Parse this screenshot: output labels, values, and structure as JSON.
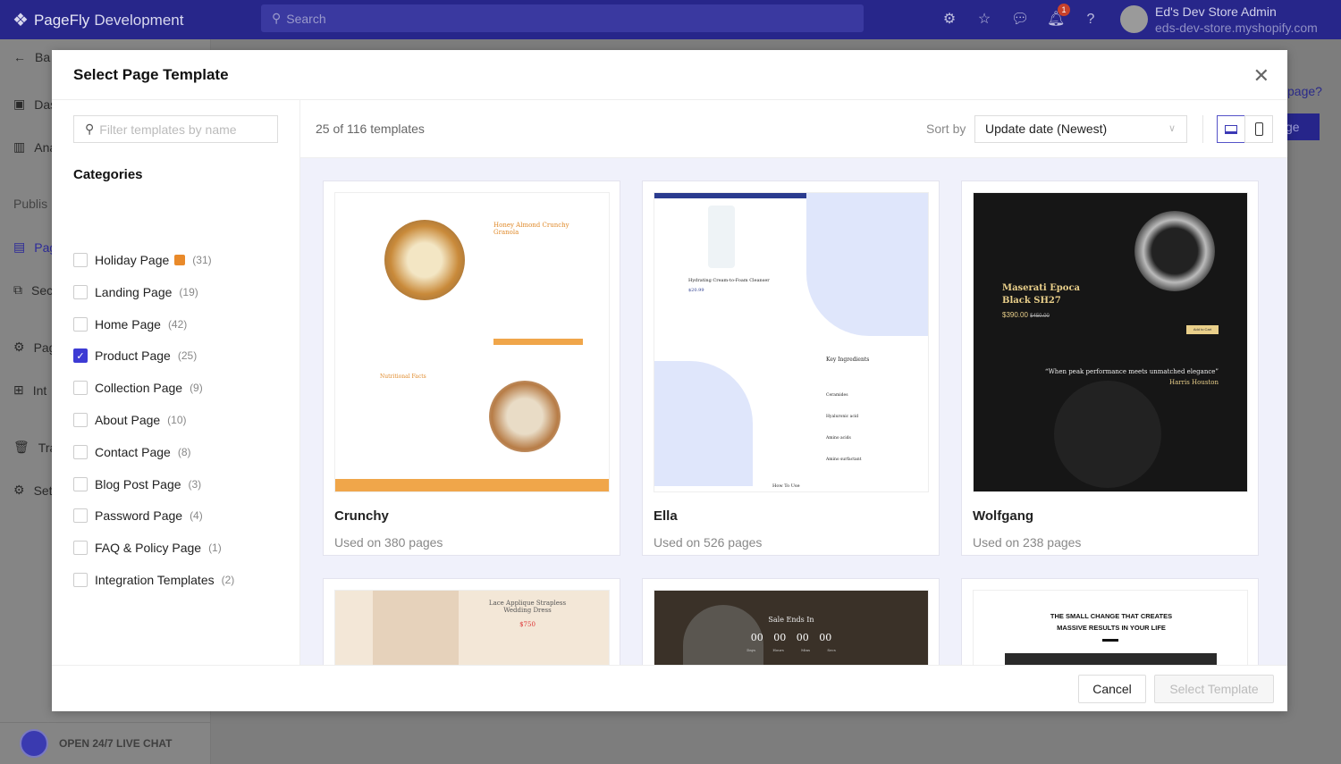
{
  "topbar": {
    "brand": "PageFly",
    "brand_suffix": "Development",
    "search_placeholder": "Search",
    "notification_count": "1",
    "user_name": "Ed's Dev Store Admin",
    "user_store": "eds-dev-store.myshopify.com",
    "brand_color": "#27268a"
  },
  "background": {
    "sidebar": [
      "Ba",
      "Das",
      "Ana",
      "Publis",
      "Pag",
      "Sec",
      "Pag",
      "Int",
      "Tra",
      "Set"
    ],
    "help_link": "page?",
    "button_fragment": "ge",
    "live_chat": "OPEN 24/7 LIVE CHAT"
  },
  "modal": {
    "title": "Select Page Template",
    "filter_placeholder": "Filter templates by name",
    "categories_title": "Categories",
    "categories": [
      {
        "label": "Holiday Page",
        "count": "(31)",
        "checked": false,
        "icon": "gift-icon"
      },
      {
        "label": "Landing Page",
        "count": "(19)",
        "checked": false
      },
      {
        "label": "Home Page",
        "count": "(42)",
        "checked": false
      },
      {
        "label": "Product Page",
        "count": "(25)",
        "checked": true
      },
      {
        "label": "Collection Page",
        "count": "(9)",
        "checked": false
      },
      {
        "label": "About Page",
        "count": "(10)",
        "checked": false
      },
      {
        "label": "Contact Page",
        "count": "(8)",
        "checked": false
      },
      {
        "label": "Blog Post Page",
        "count": "(3)",
        "checked": false
      },
      {
        "label": "Password Page",
        "count": "(4)",
        "checked": false
      },
      {
        "label": "FAQ & Policy Page",
        "count": "(1)",
        "checked": false
      },
      {
        "label": "Integration Templates",
        "count": "(2)",
        "checked": false
      }
    ],
    "result_count": "25 of 116 templates",
    "sort_label": "Sort by",
    "sort_value": "Update date (Newest)",
    "view_mode": "desktop",
    "templates": [
      {
        "name": "Crunchy",
        "used": "Used on 380 pages",
        "thumb_title": "Honey Almond Crunchy Granola",
        "thumb_section": "Nutritional Facts"
      },
      {
        "name": "Ella",
        "used": "Used on 526 pages",
        "thumb_title": "Hydrating Cream-to-Foam Cleanser",
        "thumb_price": "$20.99",
        "thumb_section": "Key Ingredients",
        "thumb_items": [
          "Ceramides",
          "Hyaluronic acid",
          "Amino acids",
          "Amino surfactant"
        ],
        "thumb_footer": "How To Use"
      },
      {
        "name": "Wolfgang",
        "used": "Used on 238 pages",
        "thumb_title": "Maserati Epoca Black SH27",
        "thumb_price": "$390.00",
        "thumb_old_price": "$450.00",
        "thumb_cta": "Add to Cart",
        "thumb_quote": "“When peak performance meets unmatched elegance”",
        "thumb_author": "Harris Houston"
      },
      {
        "thumb_title": "Lace Applique Strapless Wedding Dress",
        "thumb_price": "$750"
      },
      {
        "thumb_title": "Sale Ends In",
        "thumb_timer": [
          "00",
          "00",
          "00",
          "00"
        ],
        "thumb_units": [
          "Days",
          "Hours",
          "Mins",
          "Secs"
        ]
      },
      {
        "thumb_title": "THE SMALL CHANGE THAT CREATES MASSIVE RESULTS IN YOUR LIFE"
      }
    ],
    "cancel_label": "Cancel",
    "select_label": "Select Template"
  }
}
